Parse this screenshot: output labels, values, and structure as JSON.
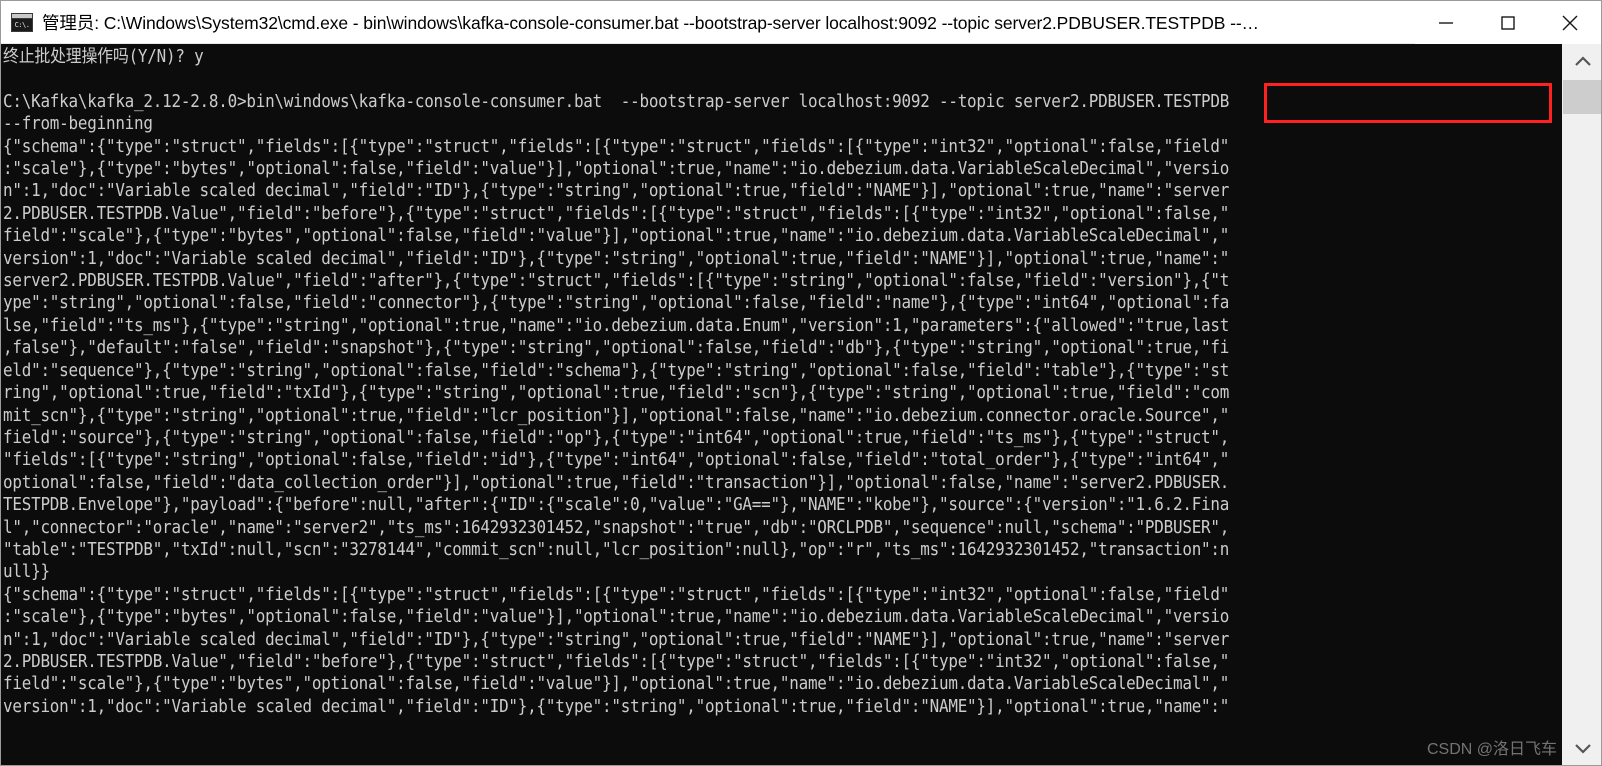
{
  "window": {
    "title": "管理员: C:\\Windows\\System32\\cmd.exe - bin\\windows\\kafka-console-consumer.bat   --bootstrap-server localhost:9092 --topic server2.PDBUSER.TESTPDB --…",
    "icon_label": "C:\\.",
    "controls": {
      "minimize": "minimize-button",
      "maximize": "maximize-button",
      "close": "close-button"
    }
  },
  "annotation": {
    "highlight_text": "server2.PDBUSER.TESTPDB",
    "color": "#ff2020"
  },
  "scrollbar": {
    "up_arrow": "▲",
    "down_arrow": "▼"
  },
  "watermark": {
    "text": "CSDN @洛日飞车"
  },
  "console": {
    "colors": {
      "background": "#0c0c0c",
      "foreground": "#cccccc"
    },
    "prompt_path": "C:\\Kafka\\kafka_2.12-2.8.0",
    "command": "bin\\windows\\kafka-console-consumer.bat  --bootstrap-server localhost:9092 --topic server2.PDBUSER.TESTPDB --from-beginning",
    "confirm_prompt": "终止批处理操作吗(Y/N)? y",
    "text": "终止批处理操作吗(Y/N)? y\n\nC:\\Kafka\\kafka_2.12-2.8.0>bin\\windows\\kafka-console-consumer.bat  --bootstrap-server localhost:9092 --topic server2.PDBUSER.TESTPDB\n--from-beginning\n{\"schema\":{\"type\":\"struct\",\"fields\":[{\"type\":\"struct\",\"fields\":[{\"type\":\"struct\",\"fields\":[{\"type\":\"int32\",\"optional\":false,\"field\"\n:\"scale\"},{\"type\":\"bytes\",\"optional\":false,\"field\":\"value\"}],\"optional\":true,\"name\":\"io.debezium.data.VariableScaleDecimal\",\"versio\nn\":1,\"doc\":\"Variable scaled decimal\",\"field\":\"ID\"},{\"type\":\"string\",\"optional\":true,\"field\":\"NAME\"}],\"optional\":true,\"name\":\"server\n2.PDBUSER.TESTPDB.Value\",\"field\":\"before\"},{\"type\":\"struct\",\"fields\":[{\"type\":\"struct\",\"fields\":[{\"type\":\"int32\",\"optional\":false,\"\nfield\":\"scale\"},{\"type\":\"bytes\",\"optional\":false,\"field\":\"value\"}],\"optional\":true,\"name\":\"io.debezium.data.VariableScaleDecimal\",\"\nversion\":1,\"doc\":\"Variable scaled decimal\",\"field\":\"ID\"},{\"type\":\"string\",\"optional\":true,\"field\":\"NAME\"}],\"optional\":true,\"name\":\"\nserver2.PDBUSER.TESTPDB.Value\",\"field\":\"after\"},{\"type\":\"struct\",\"fields\":[{\"type\":\"string\",\"optional\":false,\"field\":\"version\"},{\"t\nype\":\"string\",\"optional\":false,\"field\":\"connector\"},{\"type\":\"string\",\"optional\":false,\"field\":\"name\"},{\"type\":\"int64\",\"optional\":fa\nlse,\"field\":\"ts_ms\"},{\"type\":\"string\",\"optional\":true,\"name\":\"io.debezium.data.Enum\",\"version\":1,\"parameters\":{\"allowed\":\"true,last\n,false\"},\"default\":\"false\",\"field\":\"snapshot\"},{\"type\":\"string\",\"optional\":false,\"field\":\"db\"},{\"type\":\"string\",\"optional\":true,\"fi\neld\":\"sequence\"},{\"type\":\"string\",\"optional\":false,\"field\":\"schema\"},{\"type\":\"string\",\"optional\":false,\"field\":\"table\"},{\"type\":\"st\nring\",\"optional\":true,\"field\":\"txId\"},{\"type\":\"string\",\"optional\":true,\"field\":\"scn\"},{\"type\":\"string\",\"optional\":true,\"field\":\"com\nmit_scn\"},{\"type\":\"string\",\"optional\":true,\"field\":\"lcr_position\"}],\"optional\":false,\"name\":\"io.debezium.connector.oracle.Source\",\"\nfield\":\"source\"},{\"type\":\"string\",\"optional\":false,\"field\":\"op\"},{\"type\":\"int64\",\"optional\":true,\"field\":\"ts_ms\"},{\"type\":\"struct\",\n\"fields\":[{\"type\":\"string\",\"optional\":false,\"field\":\"id\"},{\"type\":\"int64\",\"optional\":false,\"field\":\"total_order\"},{\"type\":\"int64\",\"\noptional\":false,\"field\":\"data_collection_order\"}],\"optional\":true,\"field\":\"transaction\"}],\"optional\":false,\"name\":\"server2.PDBUSER.\nTESTPDB.Envelope\"},\"payload\":{\"before\":null,\"after\":{\"ID\":{\"scale\":0,\"value\":\"GA==\"},\"NAME\":\"kobe\"},\"source\":{\"version\":\"1.6.2.Fina\nl\",\"connector\":\"oracle\",\"name\":\"server2\",\"ts_ms\":1642932301452,\"snapshot\":\"true\",\"db\":\"ORCLPDB\",\"sequence\":null,\"schema\":\"PDBUSER\",\n\"table\":\"TESTPDB\",\"txId\":null,\"scn\":\"3278144\",\"commit_scn\":null,\"lcr_position\":null},\"op\":\"r\",\"ts_ms\":1642932301452,\"transaction\":n\null}}\n{\"schema\":{\"type\":\"struct\",\"fields\":[{\"type\":\"struct\",\"fields\":[{\"type\":\"struct\",\"fields\":[{\"type\":\"int32\",\"optional\":false,\"field\"\n:\"scale\"},{\"type\":\"bytes\",\"optional\":false,\"field\":\"value\"}],\"optional\":true,\"name\":\"io.debezium.data.VariableScaleDecimal\",\"versio\nn\":1,\"doc\":\"Variable scaled decimal\",\"field\":\"ID\"},{\"type\":\"string\",\"optional\":true,\"field\":\"NAME\"}],\"optional\":true,\"name\":\"server\n2.PDBUSER.TESTPDB.Value\",\"field\":\"before\"},{\"type\":\"struct\",\"fields\":[{\"type\":\"struct\",\"fields\":[{\"type\":\"int32\",\"optional\":false,\"\nfield\":\"scale\"},{\"type\":\"bytes\",\"optional\":false,\"field\":\"value\"}],\"optional\":true,\"name\":\"io.debezium.data.VariableScaleDecimal\",\"\nversion\":1,\"doc\":\"Variable scaled decimal\",\"field\":\"ID\"},{\"type\":\"string\",\"optional\":true,\"field\":\"NAME\"}],\"optional\":true,\"name\":\""
  }
}
